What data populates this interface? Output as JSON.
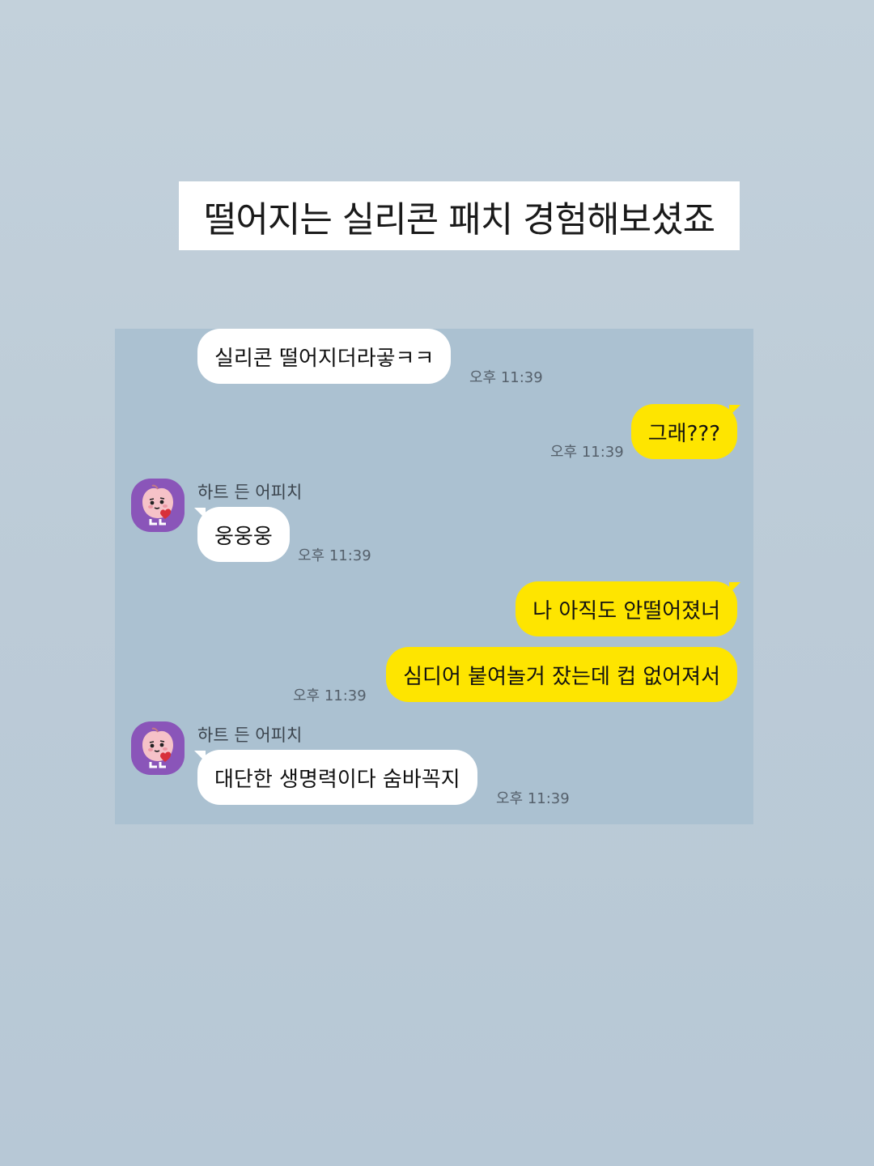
{
  "title": "떨어지는 실리콘 패치 경험해보셨죠",
  "chat": {
    "sender_name": "하트 든 어피치",
    "messages": [
      {
        "from": "other",
        "text": "실리콘 떨어지더라곻ㅋㅋ",
        "time": "오후 11:39"
      },
      {
        "from": "me",
        "text": "그래???",
        "time": "오후 11:39"
      },
      {
        "from": "other",
        "text": "웅웅웅",
        "time": "오후 11:39"
      },
      {
        "from": "me",
        "text": "나 아직도 안떨어졌너"
      },
      {
        "from": "me",
        "text": "심디어 붙여놀거 잤는데 컵 없어져서",
        "time": "오후 11:39"
      },
      {
        "from": "other",
        "text": "대단한 생명력이다 숨바꼭지",
        "time": "오후 11:39"
      }
    ]
  },
  "colors": {
    "background": "#bccbd7",
    "chat_background": "#abc1d1",
    "my_bubble": "#fee500",
    "other_bubble": "#ffffff",
    "avatar_bg": "#8a55b9"
  },
  "icons": {
    "avatar": "apeach-character-icon"
  }
}
